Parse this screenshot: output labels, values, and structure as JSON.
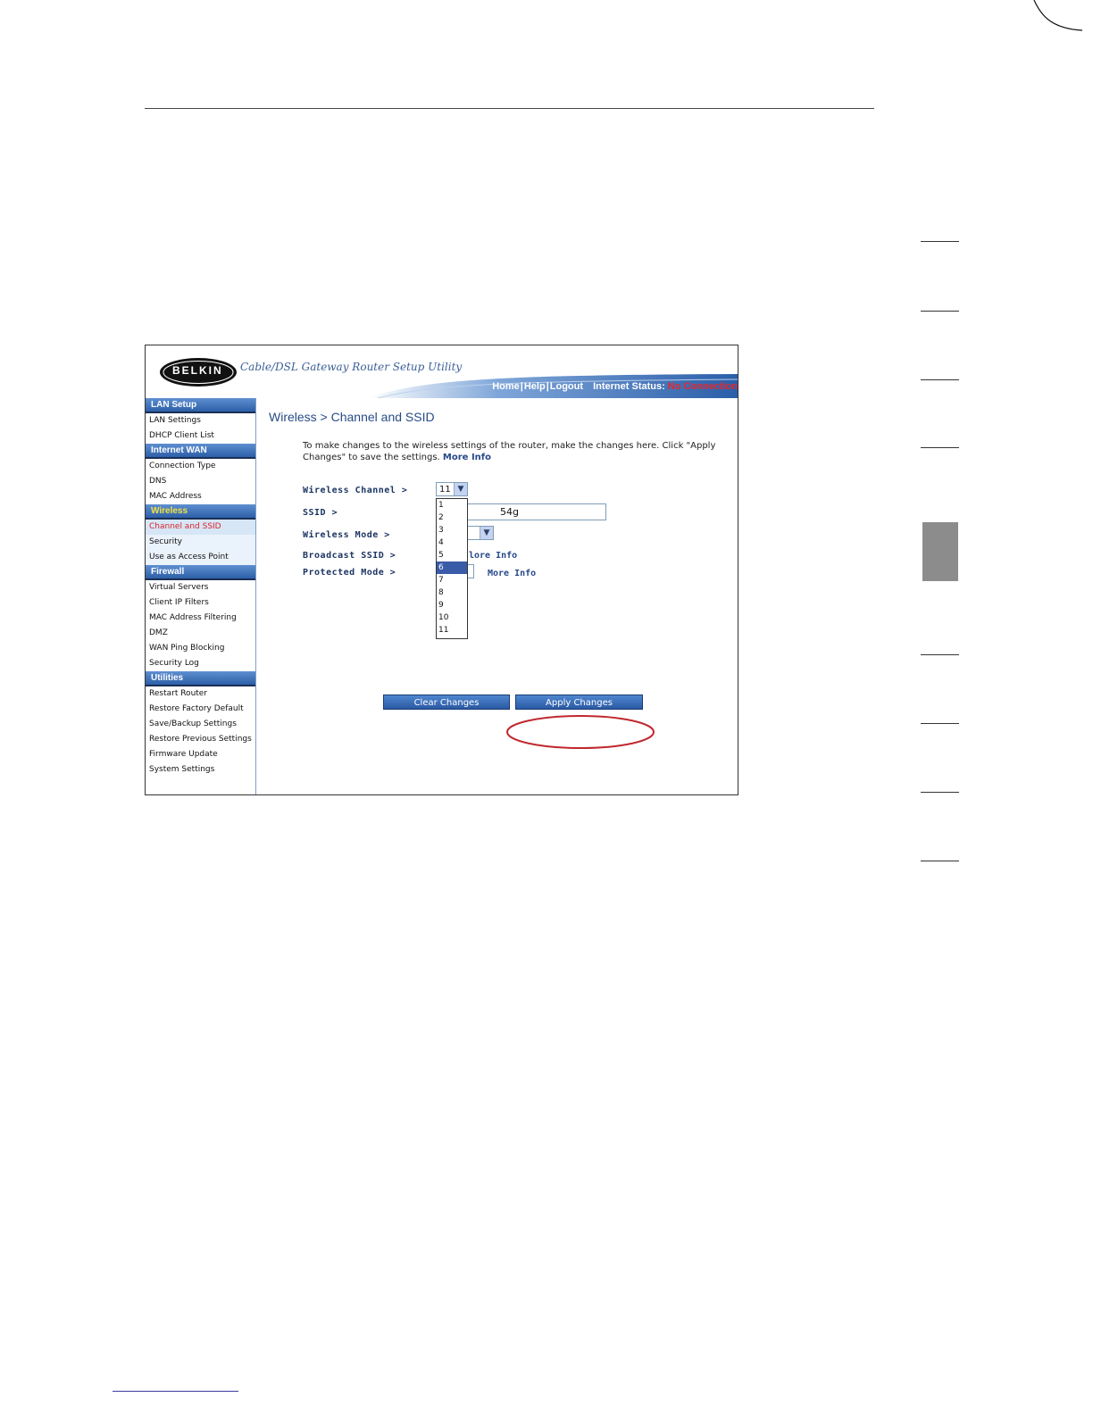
{
  "router_ui": {
    "logo": "BELKIN",
    "tagline": "Cable/DSL Gateway Router Setup Utility",
    "topnav": {
      "home": "Home",
      "help": "Help",
      "logout": "Logout",
      "separator": "|",
      "status_label": "Internet Status:",
      "status_value": "No Connection"
    },
    "sidebar": {
      "lan_setup": {
        "title": "LAN Setup",
        "items": [
          "LAN Settings",
          "DHCP Client List"
        ]
      },
      "internet_wan": {
        "title": "Internet WAN",
        "items": [
          "Connection Type",
          "DNS",
          "MAC Address"
        ]
      },
      "wireless": {
        "title": "Wireless",
        "items": [
          "Channel and SSID",
          "Security",
          "Use as Access Point"
        ]
      },
      "firewall": {
        "title": "Firewall",
        "items": [
          "Virtual Servers",
          "Client IP Filters",
          "MAC Address Filtering",
          "DMZ",
          "WAN Ping Blocking",
          "Security Log"
        ]
      },
      "utilities": {
        "title": "Utilities",
        "items": [
          "Restart Router",
          "Restore Factory Default",
          "Save/Backup Settings",
          "Restore Previous Settings",
          "Firmware Update",
          "System Settings"
        ]
      }
    },
    "main": {
      "title": "Wireless > Channel and SSID",
      "intro": "To make changes to the wireless settings of the router, make the changes here. Click \"Apply Changes\" to save the settings.",
      "intro_more": "More Info",
      "fields": {
        "wireless_channel_label": "Wireless Channel >",
        "wireless_channel_value": "11",
        "ssid_label": "SSID >",
        "ssid_value_visible": "54g",
        "wireless_mode_label": "Wireless Mode >",
        "broadcast_ssid_label": "Broadcast SSID >",
        "broadcast_more": "lore Info",
        "protected_mode_label": "Protected Mode >",
        "protected_more": "More Info"
      },
      "channel_options": [
        "1",
        "2",
        "3",
        "4",
        "5",
        "6",
        "7",
        "8",
        "9",
        "10",
        "11"
      ],
      "highlighted_option": "6",
      "buttons": {
        "clear": "Clear Changes",
        "apply": "Apply Changes"
      }
    }
  },
  "colors": {
    "brand_blue": "#2c5fa8",
    "status_red": "#e8262a",
    "highlight_ellipse": "#c0282e"
  }
}
